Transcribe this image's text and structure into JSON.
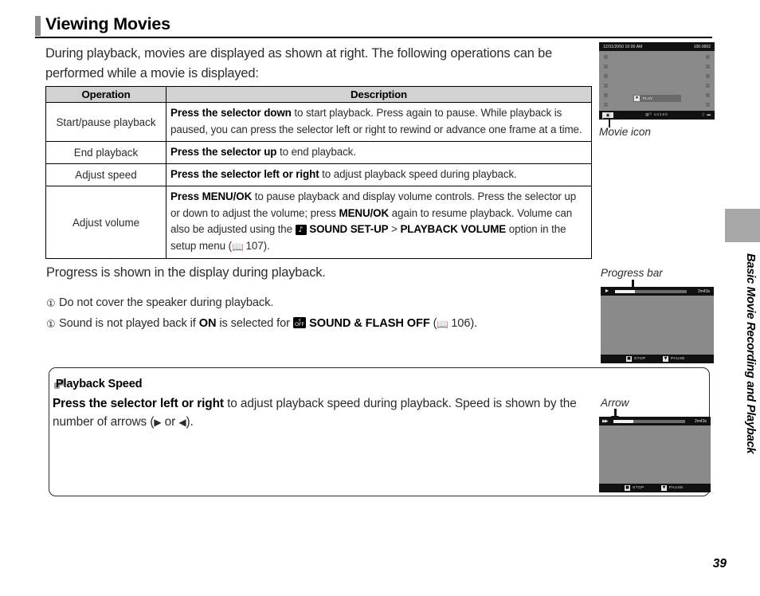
{
  "section": {
    "title": "Viewing Movies"
  },
  "intro": "During playback, movies are displayed as shown at right.  The following operations can be performed while a movie is displayed:",
  "table": {
    "headers": {
      "operation": "Operation",
      "description": "Description"
    },
    "rows": [
      {
        "operation": "Start/pause playback",
        "desc_bold": "Press the selector down",
        "desc_rest": " to start playback.  Press again to pause.  While playback is paused, you can press the selector left or right to rewind or advance one frame at a time."
      },
      {
        "operation": "End playback",
        "desc_bold": "Press the selector up",
        "desc_rest": " to end playback."
      },
      {
        "operation": "Adjust speed",
        "desc_bold": "Press the selector left or right",
        "desc_rest": " to adjust playback speed during playback."
      },
      {
        "operation": "Adjust volume",
        "volume": {
          "b1": "Press MENU/OK",
          "t1": " to pause playback and display volume controls.  Press the selector up or down to adjust the volume; press ",
          "b2": "MENU/OK",
          "t2": " again to resume playback.  Volume can also be adjusted using the ",
          "sound_icon": "♪",
          "b3": "SOUND SET-UP",
          "sep": " > ",
          "b4": "PLAYBACK VOLUME",
          "t3": " option in the setup menu (",
          "page_ref": "107",
          "t4": ")."
        }
      }
    ]
  },
  "progress_note": "Progress is shown in the display during playback.",
  "cautions": [
    {
      "mark": "①",
      "text": "Do not cover the speaker during playback."
    },
    {
      "mark": "①",
      "pre": "Sound is not played back if ",
      "bold1": "ON",
      "mid": " is selected for ",
      "icon_top": "⚡",
      "icon_bottom": "OFF",
      "bold2": "SOUND & FLASH OFF",
      "post_open": " (",
      "page_ref": "106",
      "post_close": ")."
    }
  ],
  "tip": {
    "title": "Playback Speed",
    "bold": "Press the selector left or right",
    "text": " to adjust playback speed during playback.  Speed is shown by the number of arrows (",
    "arrow_right": "▶",
    "or": " or ",
    "arrow_left": "◀",
    "close": ")."
  },
  "figures": {
    "movie_icon": {
      "caption": "Movie icon",
      "timestamp": "12/31/2050 10:00 AM",
      "file_number": "100-0002",
      "play_label": "PLAY",
      "play_key": "▼",
      "movie_badge": "▣",
      "status_mid": "▤ᴰ  ᴏᴏ100",
      "status_right": "░ ▬"
    },
    "progress_bar": {
      "caption": "Progress bar",
      "play_symbol": "▶",
      "time": "2m43s",
      "progress_percent": 28,
      "stop_key": "■",
      "stop_label": "STOP",
      "pause_key": "▼",
      "pause_label": "PAUSE"
    },
    "arrow": {
      "caption": "Arrow",
      "play_symbol": "▶▶",
      "time": "2m43s",
      "progress_percent": 28,
      "stop_key": "■",
      "stop_label": "STOP",
      "pause_key": "▼",
      "pause_label": "PAUSE"
    }
  },
  "edge_label": "Basic Movie Recording and Playback",
  "page_number": "39"
}
